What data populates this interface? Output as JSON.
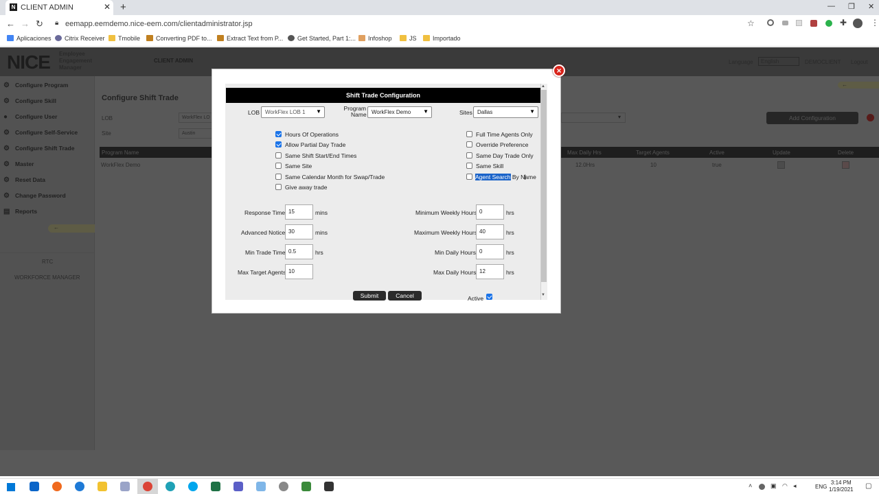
{
  "browser": {
    "tab_title": "CLIENT ADMIN",
    "url": "eemapp.eemdemo.nice-eem.com/clientadministrator.jsp",
    "bookmarks": [
      "Aplicaciones",
      "Citrix Receiver",
      "Tmobile",
      "Converting PDF to...",
      "Extract Text from P...",
      "Get Started, Part 1:...",
      "Infoshop",
      "JS",
      "Importado"
    ]
  },
  "app": {
    "logo": "NICE",
    "logo_sub": [
      "Employee",
      "Engagement",
      "Manager"
    ],
    "section": "CLIENT ADMIN",
    "language_label": "Language",
    "language_value": "English",
    "client": "DEMOCLIENT",
    "logout": "Logout",
    "nav": [
      "Configure Program",
      "Configure Skill",
      "Configure User",
      "Configure Self-Service",
      "Configure Shift Trade",
      "Master",
      "Reset Data",
      "Change Password",
      "Reports"
    ],
    "nav_bottom": [
      "RTC",
      "WORKFORCE MANAGER"
    ],
    "page_title": "Configure Shift Trade",
    "lob_label": "LOB",
    "lob_value": "WorkFlex LO",
    "site_label": "Site",
    "site_value": "Austin",
    "add_config": "Add Configuration",
    "table_headers": [
      "Program Name",
      "Max Daily Hrs",
      "Target Agents",
      "Active",
      "Update",
      "Delete"
    ],
    "table_row": [
      "WorkFlex Demo",
      "12.0Hrs",
      "10",
      "true"
    ]
  },
  "modal": {
    "title": "Shift Trade Configuration",
    "lob_label": "LOB",
    "lob_value": "WorkFlex LOB 1",
    "program_label_1": "Program",
    "program_label_2": "Name",
    "program_value": "WorkFlex Demo",
    "sites_label": "Sites",
    "sites_value": "Dallas",
    "checks_left": [
      {
        "label": "Hours Of Operations",
        "checked": true
      },
      {
        "label": "Allow Partial Day Trade",
        "checked": true
      },
      {
        "label": "Same Shift Start/End Times",
        "checked": false
      },
      {
        "label": "Same Site",
        "checked": false
      },
      {
        "label": "Same Calendar Month for Swap/Trade",
        "checked": false
      },
      {
        "label": "Give away trade",
        "checked": false
      }
    ],
    "checks_right": [
      {
        "label": "Full Time Agents Only",
        "checked": false
      },
      {
        "label": "Override Preference",
        "checked": false
      },
      {
        "label": "Same Day Trade Only",
        "checked": false
      },
      {
        "label": "Same Skill",
        "checked": false
      }
    ],
    "agent_search_sel": "Agent Search",
    "agent_search_rest": " By Name",
    "fields_left": [
      {
        "label": "Response Time",
        "value": "15",
        "unit": "mins"
      },
      {
        "label": "Advanced Notice",
        "value": "30",
        "unit": "mins"
      },
      {
        "label": "Min Trade Time",
        "value": "0.5",
        "unit": "hrs"
      },
      {
        "label": "Max Target Agents",
        "value": "10",
        "unit": ""
      }
    ],
    "fields_right": [
      {
        "label": "Minimum Weekly Hours",
        "value": "0",
        "unit": "hrs"
      },
      {
        "label": "Maximum Weekly Hours",
        "value": "40",
        "unit": "hrs"
      },
      {
        "label": "Min Daily Hours",
        "value": "0",
        "unit": "hrs"
      },
      {
        "label": "Max Daily Hours",
        "value": "12",
        "unit": "hrs"
      }
    ],
    "submit": "Submit",
    "cancel": "Cancel",
    "active_label": "Active",
    "active_checked": true
  },
  "taskbar": {
    "lang": "ENG",
    "time": "3:14 PM",
    "date": "1/19/2021"
  }
}
